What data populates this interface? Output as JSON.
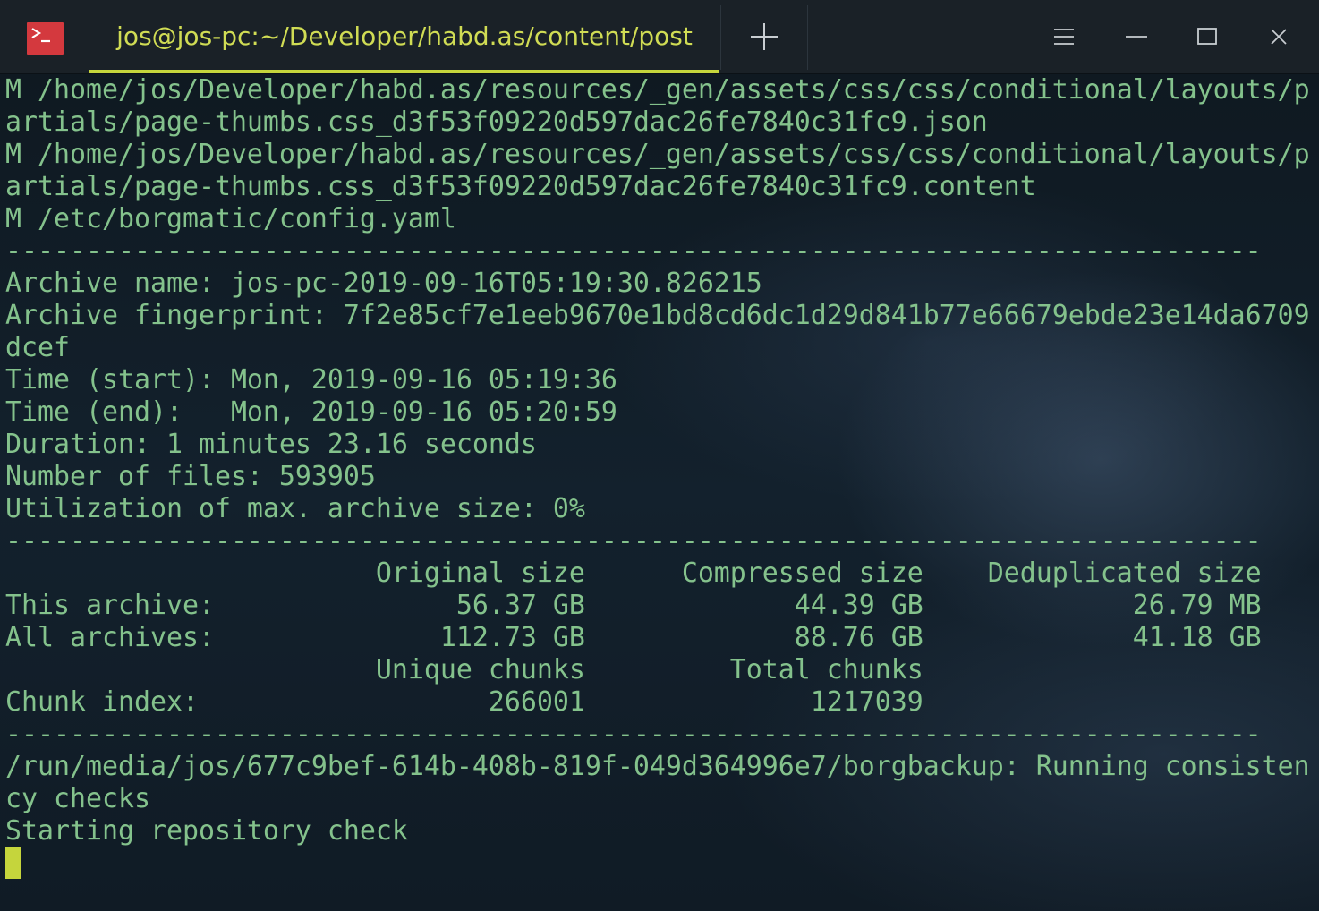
{
  "window": {
    "tab_title": "jos@jos-pc:~/Developer/habd.as/content/post",
    "new_tab_label": "+",
    "colors": {
      "accent": "#c5d53c",
      "terminal_text": "#84c28c",
      "app_icon_bg": "#d4393e"
    },
    "icons": [
      "terminal-app-icon",
      "plus-icon",
      "menu-icon",
      "minimize-icon",
      "maximize-icon",
      "close-icon"
    ]
  },
  "terminal": {
    "lines": [
      "M /home/jos/Developer/habd.as/resources/_gen/assets/css/css/conditional/layouts/p",
      "artials/page-thumbs.css_d3f53f09220d597dac26fe7840c31fc9.json",
      "M /home/jos/Developer/habd.as/resources/_gen/assets/css/css/conditional/layouts/p",
      "artials/page-thumbs.css_d3f53f09220d597dac26fe7840c31fc9.content",
      "M /etc/borgmatic/config.yaml",
      "------------------------------------------------------------------------------",
      "Archive name: jos-pc-2019-09-16T05:19:30.826215",
      "Archive fingerprint: 7f2e85cf7e1eeb9670e1bd8cd6dc1d29d841b77e66679ebde23e14da6709",
      "dcef",
      "Time (start): Mon, 2019-09-16 05:19:36",
      "Time (end):   Mon, 2019-09-16 05:20:59",
      "Duration: 1 minutes 23.16 seconds",
      "Number of files: 593905",
      "Utilization of max. archive size: 0%",
      "------------------------------------------------------------------------------",
      "                       Original size      Compressed size    Deduplicated size",
      "This archive:               56.37 GB             44.39 GB             26.79 MB",
      "All archives:              112.73 GB             88.76 GB             41.18 GB",
      "                       Unique chunks         Total chunks",
      "Chunk index:                  266001              1217039",
      "------------------------------------------------------------------------------",
      "/run/media/jos/677c9bef-614b-408b-819f-049d364996e7/borgbackup: Running consisten",
      "cy checks",
      "Starting repository check"
    ]
  }
}
